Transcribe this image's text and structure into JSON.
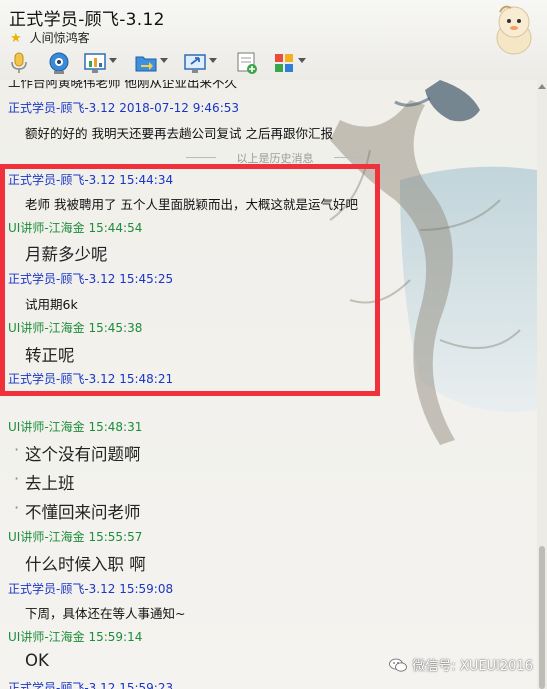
{
  "window": {
    "title": "正式学员-顾飞-3.12",
    "signature": "人间惊鸿客"
  },
  "toolbar": {
    "icons": [
      "microphone-icon",
      "video-call-icon",
      "remote-desktop-icon",
      "file-transfer-icon",
      "screen-share-icon",
      "notes-icon",
      "apps-grid-icon"
    ]
  },
  "history": {
    "cut_text": "工作台阿黄晓伟老师 他刚从企业出来不久",
    "msg1_meta": "正式学员-顾飞-3.12 2018-07-12 9:46:53",
    "msg1_text": "额好的好的 我明天还要再去趟公司复试 之后再跟你汇报",
    "separator": "以上是历史消息"
  },
  "messages": [
    {
      "meta": "正式学员-顾飞-3.12   15:44:34",
      "text": "老师 我被聘用了 五个人里面脱颖而出，大概这就是运气好吧"
    },
    {
      "meta": "UI讲师-江海金   15:44:54",
      "text": "月薪多少呢"
    },
    {
      "meta": "正式学员-顾飞-3.12   15:45:25",
      "text": "试用期6k"
    },
    {
      "meta": "UI讲师-江海金   15:45:38",
      "text": "转正呢"
    },
    {
      "meta": "正式学员-顾飞-3.12   15:48:21",
      "text": ""
    },
    {
      "meta": "UI讲师-江海金   15:48:31",
      "lines": [
        "这个没有问题啊",
        "去上班",
        "不懂回来问老师"
      ]
    },
    {
      "meta": "UI讲师-江海金   15:55:57",
      "text": "什么时候入职 啊"
    },
    {
      "meta": "正式学员-顾飞-3.12   15:59:08",
      "text": "下周，具体还在等人事通知~"
    },
    {
      "meta": "UI讲师-江海金   15:59:14",
      "text": "OK"
    },
    {
      "meta": "正式学员-顾飞-3.12   15:59:23",
      "text": ""
    }
  ],
  "watermark": "微信号: XUEUI2016",
  "colors": {
    "student_name": "#1a36c4",
    "teacher_name": "#1c8d3a",
    "highlight": "#f0303a"
  }
}
